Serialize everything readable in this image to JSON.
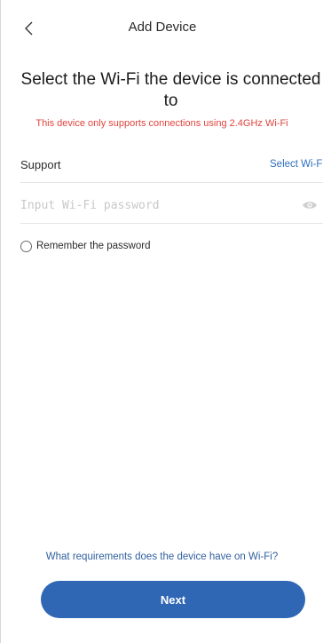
{
  "header": {
    "title": "Add Device",
    "back_icon": "chevron-left-icon"
  },
  "main": {
    "title": "Select the Wi-Fi the device is connected to",
    "warning": "This device only supports connections using 2.4GHz Wi-Fi",
    "warning_color": "#e0443e"
  },
  "wifi": {
    "network_name": "Support",
    "select_label": "Select Wi-Fi",
    "password_value": "",
    "password_placeholder": "Input Wi-Fi password",
    "visibility_icon": "eye-icon"
  },
  "remember": {
    "label": "Remember the password",
    "checked": false
  },
  "footer": {
    "requirements_link": "What requirements does the device have on Wi-Fi?",
    "next_label": "Next",
    "accent_color": "#2f67b5"
  }
}
